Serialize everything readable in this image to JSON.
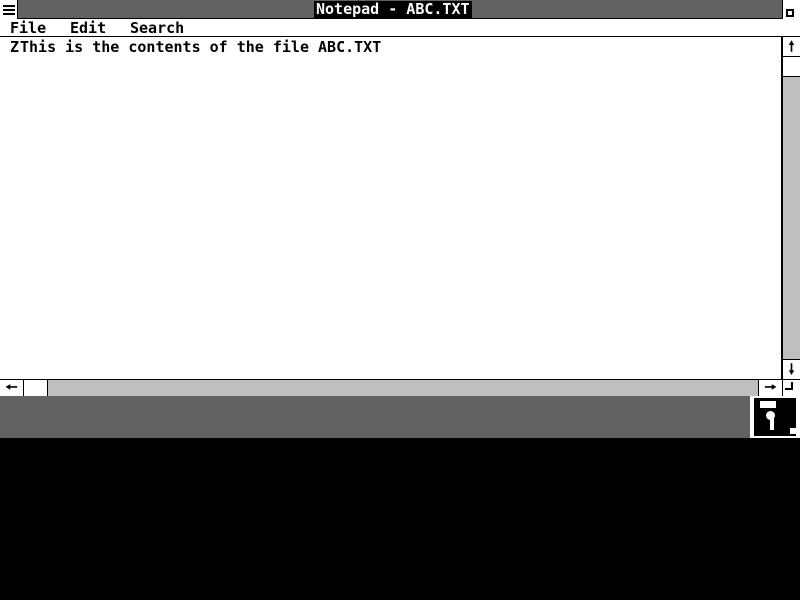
{
  "window": {
    "title": "Notepad - ABC.TXT",
    "system_menu_icon": "system-menu-icon",
    "maximize_icon": "maximize-icon"
  },
  "menubar": {
    "items": [
      {
        "label": "File"
      },
      {
        "label": "Edit"
      },
      {
        "label": "Search"
      }
    ]
  },
  "editor": {
    "caret_char": "Z",
    "content": "This is the contents of the file ABC.TXT"
  },
  "scrollbars": {
    "up_arrow": "🠕",
    "down_arrow": "🠗",
    "left_arrow": "🠔",
    "right_arrow": "🠖"
  },
  "desktop": {
    "icons": [
      {
        "name": "floppy-disk-icon"
      }
    ]
  },
  "colors": {
    "foreground": "#000000",
    "background": "#ffffff"
  }
}
